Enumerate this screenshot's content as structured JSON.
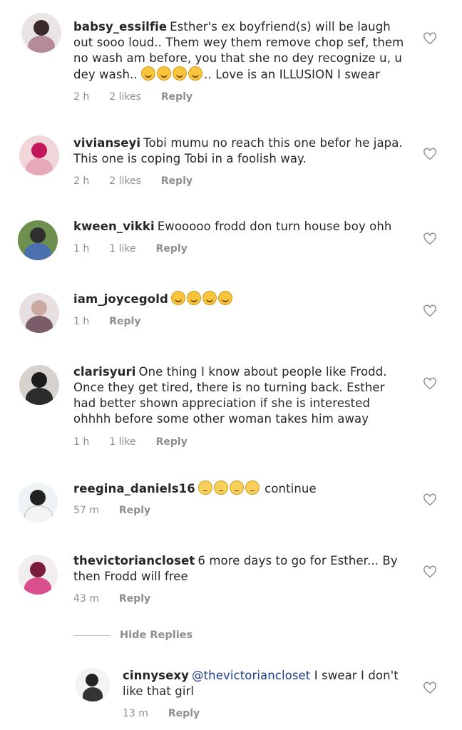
{
  "comments": [
    {
      "username": "babsy_essilfie",
      "text_a": "Esther's ex boyfriend(s) will be laugh out sooo loud.. Them wey them remove chop sef, them no wash am before, you that she no dey recognize u, u dey wash..",
      "emoji_count": 4,
      "text_b": ".. Love is an ILLUSION I swear",
      "time": "2 h",
      "likes": "2 likes",
      "reply": "Reply"
    },
    {
      "username": "vivianseyi",
      "text_a": "Tobi mumu no reach this one befor he japa. This one is coping Tobi in a foolish way.",
      "time": "2 h",
      "likes": "2 likes",
      "reply": "Reply"
    },
    {
      "username": "kween_vikki",
      "text_a": "Ewooooo frodd don turn house boy ohh",
      "time": "1 h",
      "likes": "1 like",
      "reply": "Reply"
    },
    {
      "username": "iam_joycegold",
      "emoji_count": 4,
      "time": "1 h",
      "reply": "Reply"
    },
    {
      "username": "clarisyuri",
      "text_a": "One thing I know about people like Frodd. Once they get tired, there is no turning back. Esther had better shown appreciation if she is interested ohhhh before some other woman takes him away",
      "time": "1 h",
      "likes": "1 like",
      "reply": "Reply"
    },
    {
      "username": "reegina_daniels16",
      "emoji_count": 4,
      "text_b": "continue",
      "time": "57 m",
      "reply": "Reply"
    },
    {
      "username": "thevictoriancloset",
      "text_a": "6 more days to go for Esther... By then Frodd will free",
      "time": "43 m",
      "reply": "Reply"
    }
  ],
  "hide_replies": "Hide Replies",
  "reply_comment": {
    "username": "cinnysexy",
    "mention": "@thevictoriancloset",
    "text": "I swear I don't like that girl",
    "time": "13 m",
    "reply": "Reply"
  }
}
